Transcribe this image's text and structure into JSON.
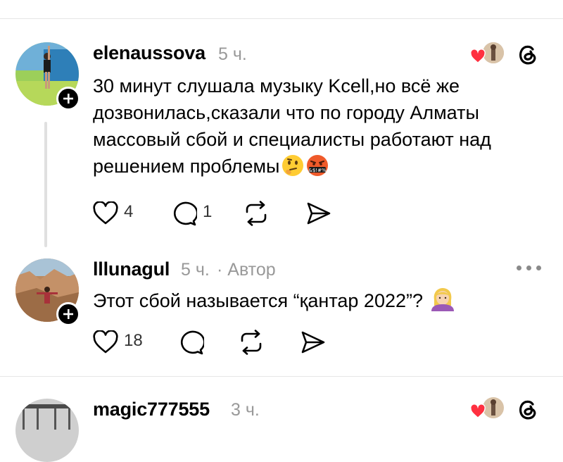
{
  "comments": [
    {
      "username": "elenaussova",
      "time": "5 ч.",
      "lines": [
        "30 минут слушала музыку Kcell,но всё же",
        "дозвонилась,сказали что по городу Алматы",
        "массовый сбой и специалисты работают над",
        "решением проблемы"
      ],
      "emoji_grawlix": "&$!#%",
      "likes": "4",
      "replies": "1"
    },
    {
      "username": "lllunagul",
      "time": "5 ч.",
      "author_badge": "· Автор",
      "text": "Этот сбой называется “қантар 2022”?",
      "likes": "18"
    },
    {
      "username": "magic777555",
      "time": "3 ч."
    }
  ],
  "icons": {
    "like": "heart-icon",
    "reply": "speech-bubble-icon",
    "repost": "repost-icon",
    "share": "send-icon",
    "threads": "threads-logo-icon",
    "more": "more-icon"
  },
  "colors": {
    "heart_red": "#ff3040",
    "secondary_text": "#999999",
    "divider": "#e6e6e6"
  }
}
